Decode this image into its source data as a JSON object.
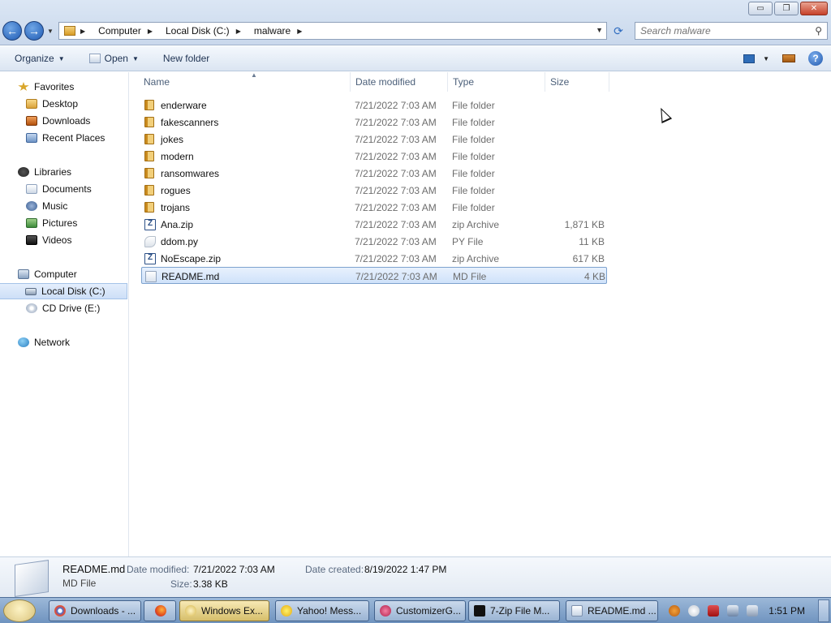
{
  "window": {
    "minimize": "▭",
    "maximize": "❐",
    "close": "✕"
  },
  "address": {
    "crumbs": [
      "Computer",
      "Local Disk (C:)",
      "malware"
    ],
    "search_placeholder": "Search malware"
  },
  "toolbar": {
    "organize": "Organize",
    "open": "Open",
    "new_folder": "New folder"
  },
  "nav": {
    "favorites": "Favorites",
    "desktop": "Desktop",
    "downloads": "Downloads",
    "recent": "Recent Places",
    "libraries": "Libraries",
    "documents": "Documents",
    "music": "Music",
    "pictures": "Pictures",
    "videos": "Videos",
    "computer": "Computer",
    "local_disk": "Local Disk (C:)",
    "cd_drive": "CD Drive (E:)",
    "network": "Network"
  },
  "columns": {
    "name": "Name",
    "date": "Date modified",
    "type": "Type",
    "size": "Size"
  },
  "files": [
    {
      "name": "enderware",
      "date": "7/21/2022 7:03 AM",
      "type": "File folder",
      "size": ""
    },
    {
      "name": "fakescanners",
      "date": "7/21/2022 7:03 AM",
      "type": "File folder",
      "size": ""
    },
    {
      "name": "jokes",
      "date": "7/21/2022 7:03 AM",
      "type": "File folder",
      "size": ""
    },
    {
      "name": "modern",
      "date": "7/21/2022 7:03 AM",
      "type": "File folder",
      "size": ""
    },
    {
      "name": "ransomwares",
      "date": "7/21/2022 7:03 AM",
      "type": "File folder",
      "size": ""
    },
    {
      "name": "rogues",
      "date": "7/21/2022 7:03 AM",
      "type": "File folder",
      "size": ""
    },
    {
      "name": "trojans",
      "date": "7/21/2022 7:03 AM",
      "type": "File folder",
      "size": ""
    },
    {
      "name": "Ana.zip",
      "date": "7/21/2022 7:03 AM",
      "type": "zip Archive",
      "size": "1,871 KB"
    },
    {
      "name": "ddom.py",
      "date": "7/21/2022 7:03 AM",
      "type": "PY File",
      "size": "11 KB"
    },
    {
      "name": "NoEscape.zip",
      "date": "7/21/2022 7:03 AM",
      "type": "zip Archive",
      "size": "617 KB"
    },
    {
      "name": "README.md",
      "date": "7/21/2022 7:03 AM",
      "type": "MD File",
      "size": "4 KB"
    }
  ],
  "details": {
    "name": "README.md",
    "type": "MD File",
    "date_modified_label": "Date modified:",
    "date_modified": "7/21/2022 7:03 AM",
    "date_created_label": "Date created:",
    "date_created": "8/19/2022 1:47 PM",
    "size_label": "Size:",
    "size": "3.38 KB"
  },
  "taskbar": {
    "tasks": [
      "Downloads - ...",
      "",
      "Windows Ex...",
      "Yahoo! Mess...",
      "CustomizerG...",
      "7-Zip File M...",
      "README.md ..."
    ],
    "clock": "1:51 PM"
  }
}
